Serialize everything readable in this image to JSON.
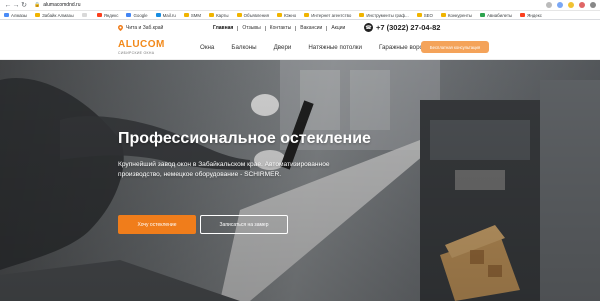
{
  "browser": {
    "url": "alumacomdnd.ru",
    "bookmarks": [
      {
        "label": "Алмазы",
        "color": "#4a8cf7"
      },
      {
        "label": "Забайк Алмазы",
        "color": "#f0b400"
      },
      {
        "label": "",
        "color": "#d9d9d9"
      },
      {
        "label": "Яндекс",
        "color": "#fc3f1d"
      },
      {
        "label": "Google",
        "color": "#4285f4"
      },
      {
        "label": "Mail.ru",
        "color": "#168de2"
      },
      {
        "label": "SMM",
        "color": "#f0b400"
      },
      {
        "label": "Карты",
        "color": "#f0b400"
      },
      {
        "label": "Объявления",
        "color": "#f0b400"
      },
      {
        "label": "Южно",
        "color": "#f0b400"
      },
      {
        "label": "Интернет агентство",
        "color": "#f0b400"
      },
      {
        "label": "Инструменты граф...",
        "color": "#f0b400"
      },
      {
        "label": "SEO",
        "color": "#f0b400"
      },
      {
        "label": "Конкуренты",
        "color": "#f0b400"
      },
      {
        "label": "Авиабилеты",
        "color": "#2ea44f"
      },
      {
        "label": "Яндекс",
        "color": "#fc3f1d"
      }
    ]
  },
  "topbar": {
    "city": "Чита и Заб.край",
    "links": [
      "Главная",
      "Отзывы",
      "Контакты",
      "Вакансии",
      "Акции"
    ],
    "phone": "+7 (3022) 27-04-82"
  },
  "nav": {
    "logo": "ALUCOM",
    "logo_sub": "СИБИРСКИЕ ОКНА",
    "items": [
      "Окна",
      "Балконы",
      "Двери",
      "Натяжные потолки",
      "Гаражные ворота"
    ],
    "cta": "Бесплатная консультация"
  },
  "hero": {
    "title": "Профессиональное остекление",
    "description": "Крупнейший завод окон в Забайкальском крае. Автоматизированное производство, немецкое оборудование - SCHIRMER.",
    "primary_button": "Хочу остекление",
    "secondary_button": "Записаться на замер"
  },
  "colors": {
    "brand_orange": "#f07d1b",
    "cta_orange": "#f4a35a"
  }
}
